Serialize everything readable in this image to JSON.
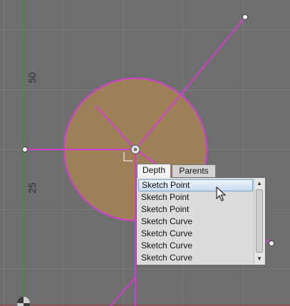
{
  "viewport": {
    "axis_labels": [
      "50",
      "25"
    ],
    "colors": {
      "background": "#6e6e6e",
      "grid": "#7c7c7c",
      "sketch_line": "#d23fd0",
      "disc_fill": "#9e8058",
      "vertical_axis": "#3f8a3f"
    }
  },
  "popup": {
    "tabs": [
      {
        "label": "Depth",
        "active": true
      },
      {
        "label": "Parents",
        "active": false
      }
    ],
    "items": [
      {
        "label": "Sketch Point",
        "selected": true
      },
      {
        "label": "Sketch Point",
        "selected": false
      },
      {
        "label": "Sketch Point",
        "selected": false
      },
      {
        "label": "Sketch Curve",
        "selected": false
      },
      {
        "label": "Sketch Curve",
        "selected": false
      },
      {
        "label": "Sketch Curve",
        "selected": false
      },
      {
        "label": "Sketch Curve",
        "selected": false
      }
    ],
    "scroll_up_icon": "triangle-up",
    "scroll_down_icon": "triangle-down"
  },
  "cursor_icon": "arrow-pointer"
}
